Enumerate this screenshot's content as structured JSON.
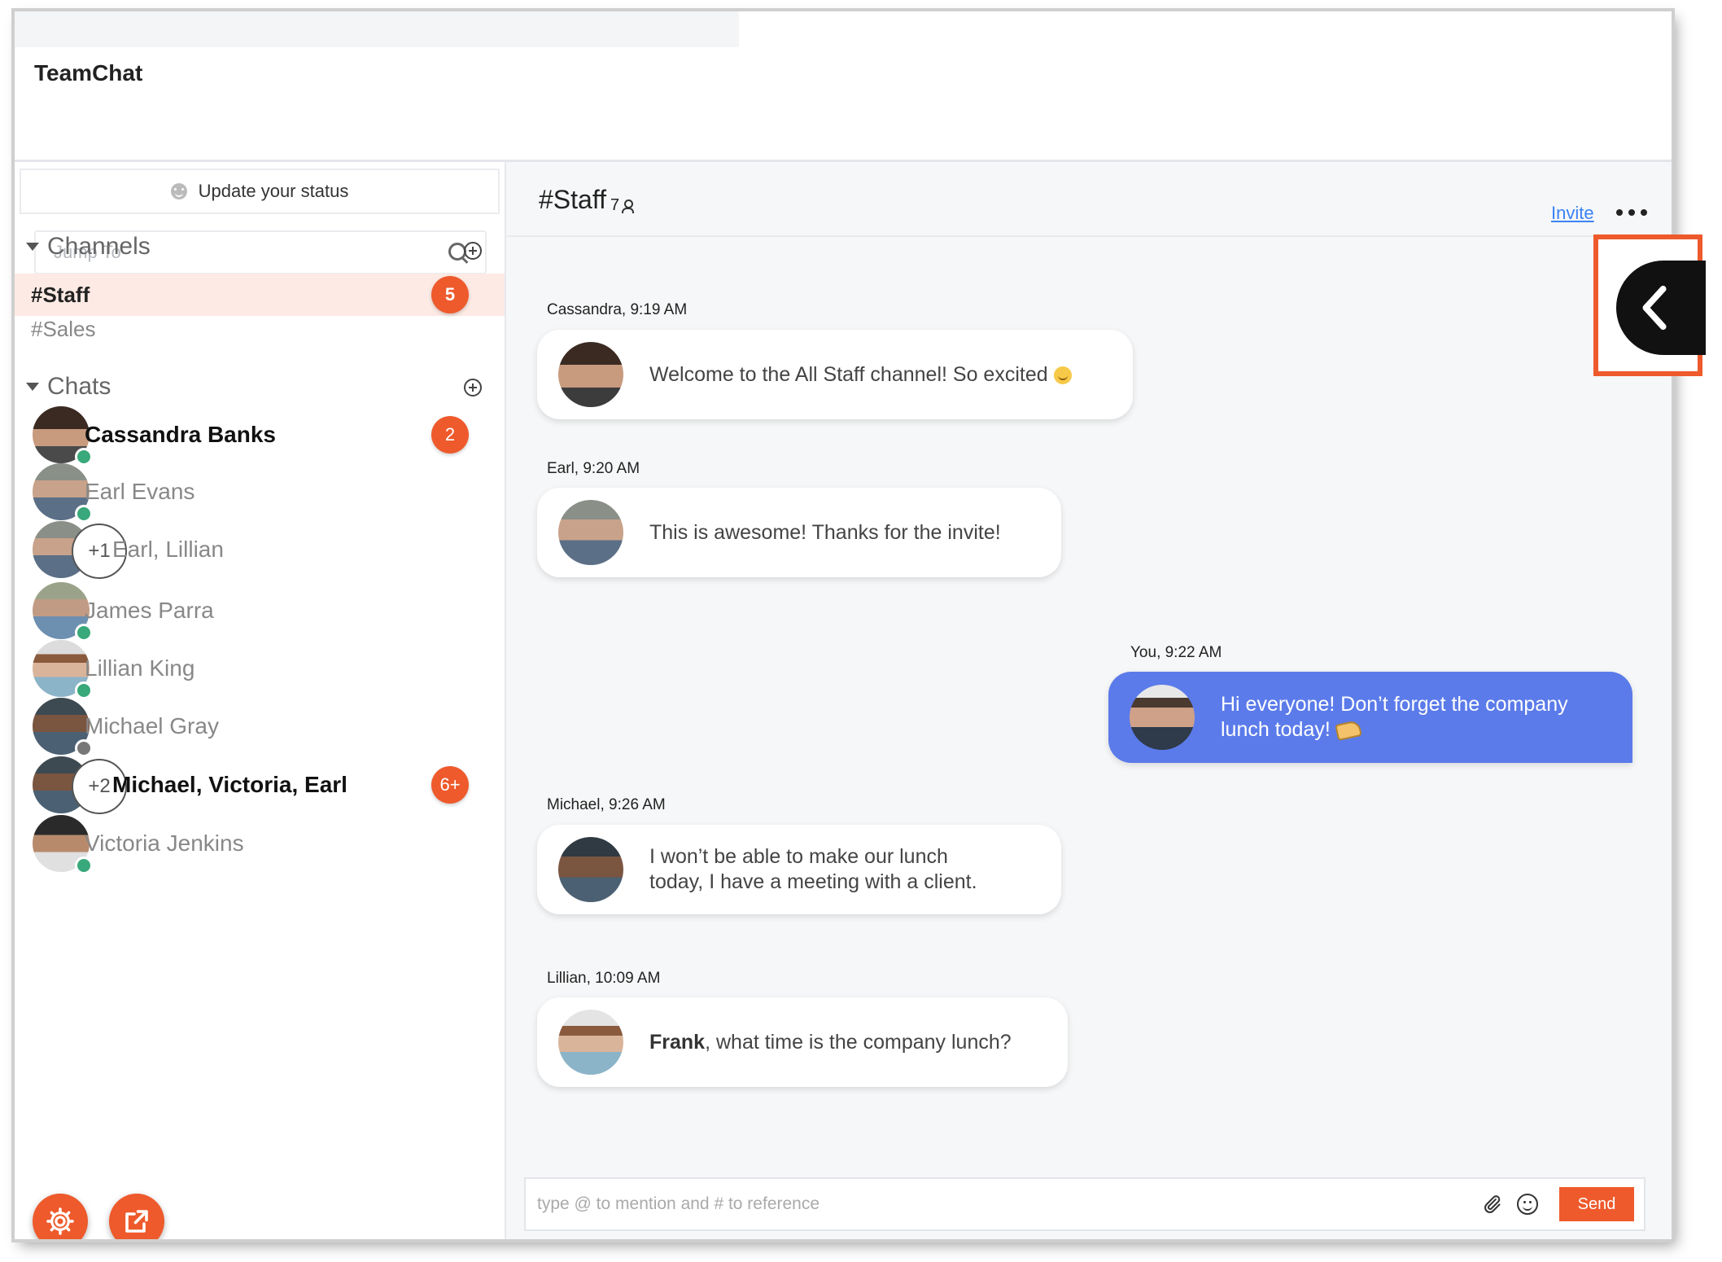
{
  "app": {
    "title": "TeamChat"
  },
  "sidebar": {
    "status_label": "Update your status",
    "search_placeholder": "Jump To",
    "channels_heading": "Channels",
    "channels": [
      {
        "name": "#Staff",
        "badge": "5",
        "active": true
      },
      {
        "name": "#Sales",
        "badge": null,
        "active": false
      }
    ],
    "chats_heading": "Chats",
    "chats": [
      {
        "name": "Cassandra Banks",
        "badge": "2",
        "bold": true,
        "presence": "online"
      },
      {
        "name": "Earl Evans",
        "badge": null,
        "bold": false,
        "presence": "online"
      },
      {
        "name": "Earl, Lillian",
        "extra": "+1",
        "badge": null,
        "bold": false
      },
      {
        "name": "James Parra",
        "badge": null,
        "bold": false,
        "presence": "online"
      },
      {
        "name": "Lillian King",
        "badge": null,
        "bold": false,
        "presence": "online"
      },
      {
        "name": "Michael Gray",
        "badge": null,
        "bold": false,
        "presence": "away"
      },
      {
        "name": "Michael, Victoria, Earl",
        "extra": "+2",
        "badge": "6+",
        "bold": true
      },
      {
        "name": "Victoria Jenkins",
        "badge": null,
        "bold": false,
        "presence": "online"
      }
    ]
  },
  "channel": {
    "name": "#Staff",
    "member_count": "7",
    "invite_label": "Invite"
  },
  "messages": [
    {
      "meta": "Cassandra, 9:19 AM",
      "text": "Welcome to the All Staff channel! So excited",
      "mine": false
    },
    {
      "meta": "Earl, 9:20 AM",
      "text": "This is awesome! Thanks for the invite!",
      "mine": false
    },
    {
      "meta": "You, 9:22 AM",
      "text_line1": "Hi everyone! Don’t forget the company",
      "text_line2": "lunch today!",
      "mine": true
    },
    {
      "meta": "Michael, 9:26 AM",
      "text_line1": "I won’t be able to make our lunch",
      "text_line2": "today, I have a meeting with a client.",
      "mine": false
    },
    {
      "meta": "Lillian, 10:09 AM",
      "mention": "Frank",
      "text": ", what time is the company lunch?",
      "mine": false
    }
  ],
  "composer": {
    "placeholder": "type @ to mention and # to reference",
    "send_label": "Send"
  },
  "colors": {
    "accent": "#ee5a2c",
    "own_bubble": "#5b7bea",
    "active_channel_bg": "#fdeae4",
    "online": "#39a87a"
  }
}
